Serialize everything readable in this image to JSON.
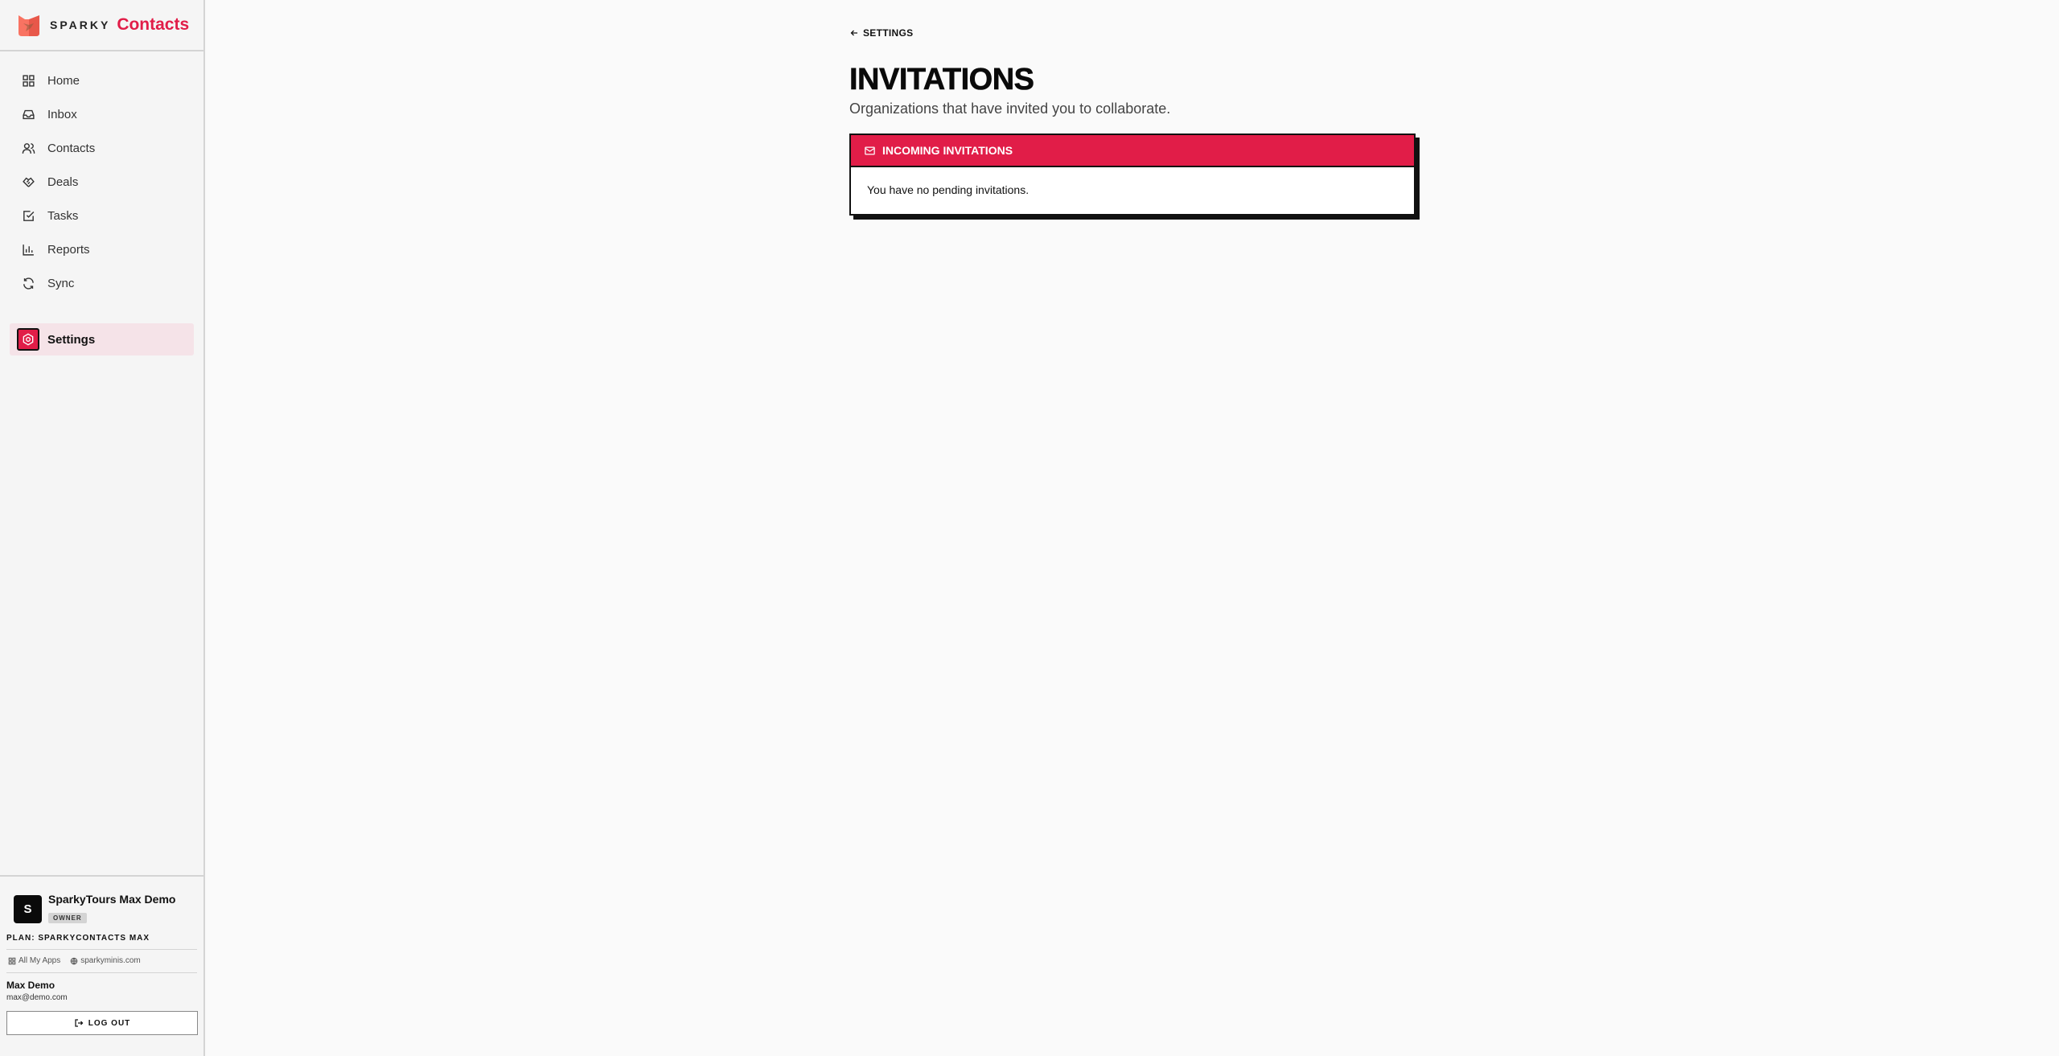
{
  "brand": {
    "sparky": "SPARKY",
    "product": "Contacts"
  },
  "nav": {
    "items": [
      {
        "label": "Home",
        "icon": "home-icon"
      },
      {
        "label": "Inbox",
        "icon": "inbox-icon"
      },
      {
        "label": "Contacts",
        "icon": "contacts-icon"
      },
      {
        "label": "Deals",
        "icon": "handshake-icon"
      },
      {
        "label": "Tasks",
        "icon": "task-check-icon"
      },
      {
        "label": "Reports",
        "icon": "bar-chart-icon"
      },
      {
        "label": "Sync",
        "icon": "sync-icon"
      }
    ],
    "active": {
      "label": "Settings",
      "icon": "gear-icon"
    }
  },
  "org": {
    "initial": "S",
    "name": "SparkyTours Max Demo",
    "role": "OWNER"
  },
  "plan": "PLAN: SPARKYCONTACTS MAX",
  "links": {
    "all_apps": "All My Apps",
    "site": "sparkyminis.com"
  },
  "user": {
    "name": "Max Demo",
    "email": "max@demo.com"
  },
  "logout_label": "LOG OUT",
  "main": {
    "back_label": "SETTINGS",
    "title": "INVITATIONS",
    "subtitle": "Organizations that have invited you to collaborate.",
    "card": {
      "header": "INCOMING INVITATIONS",
      "empty_message": "You have no pending invitations."
    }
  },
  "colors": {
    "accent": "#e11d48",
    "active_bg": "#f5e3e8",
    "border": "#111111"
  }
}
